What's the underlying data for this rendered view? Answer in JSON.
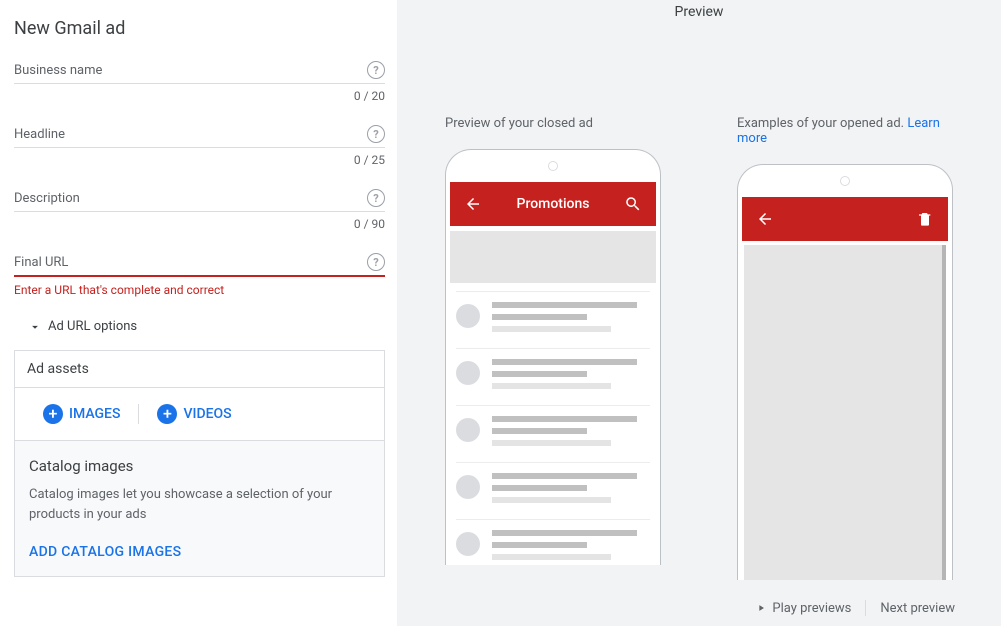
{
  "page_title": "New Gmail ad",
  "fields": {
    "business_name": {
      "label": "Business name",
      "counter": "0 / 20"
    },
    "headline": {
      "label": "Headline",
      "counter": "0 / 25"
    },
    "description": {
      "label": "Description",
      "counter": "0 / 90"
    },
    "final_url": {
      "label": "Final URL",
      "error": "Enter a URL that's complete and correct"
    }
  },
  "url_options": "Ad URL options",
  "assets": {
    "header": "Ad assets",
    "images_btn": "IMAGES",
    "videos_btn": "VIDEOS"
  },
  "catalog": {
    "title": "Catalog images",
    "desc": "Catalog images let you showcase a selection of your products in your ads",
    "add_btn": "ADD CATALOG IMAGES"
  },
  "preview": {
    "header": "Preview",
    "closed_label": "Preview of your closed ad",
    "opened_label": "Examples of your opened ad.",
    "learn_more": "Learn more",
    "promotions": "Promotions",
    "play": "Play previews",
    "next": "Next preview"
  }
}
